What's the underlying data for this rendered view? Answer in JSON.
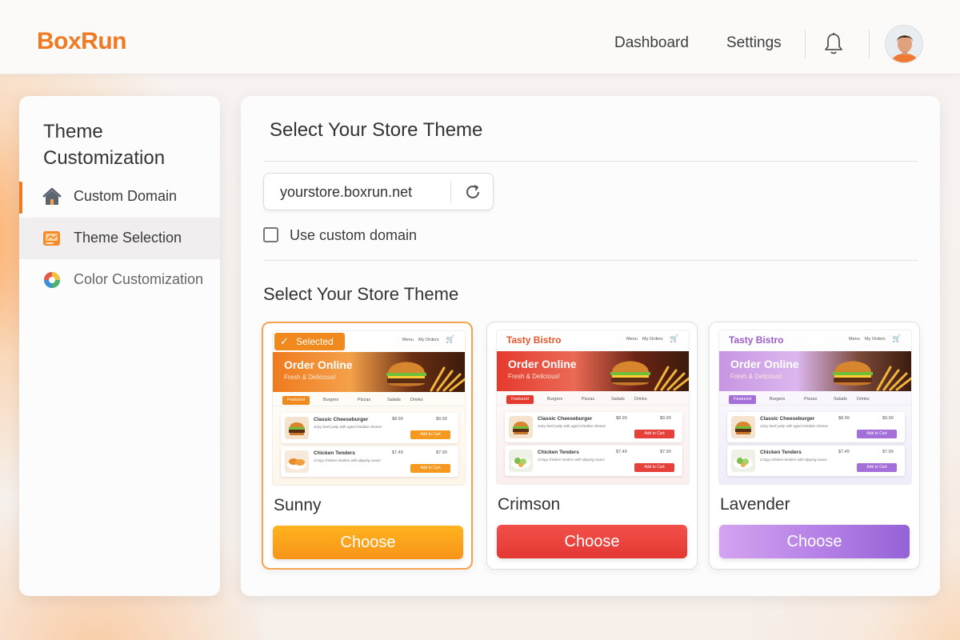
{
  "header": {
    "brand": "BoxRun",
    "nav": [
      "Dashboard",
      "Settings"
    ],
    "icons": [
      "bell-icon",
      "avatar"
    ]
  },
  "sidebar": {
    "title": "Theme Customization",
    "items": [
      {
        "label": "Custom Domain",
        "icon": "home-icon",
        "state": "active-accent"
      },
      {
        "label": "Theme Selection",
        "icon": "palette-card-icon",
        "state": "highlighted"
      },
      {
        "label": "Color Customization",
        "icon": "color-wheel-icon",
        "state": "default"
      }
    ]
  },
  "main": {
    "title": "Select Your Store Theme",
    "domain": {
      "value": "yourstore.boxrun.net",
      "refresh_icon": "refresh-icon"
    },
    "custom_domain_checkbox": {
      "label": "Use custom domain",
      "checked": false
    },
    "section_title": "Select Your Store Theme"
  },
  "preview": {
    "brand": "Tasty Bistro",
    "selected_badge": "Selected",
    "nav_menu": "Menu",
    "nav_orders": "My Orders",
    "hero_title": "Order Online",
    "hero_sub": "Fresh & Delicious!",
    "tabs": [
      "Featured",
      "Burgers",
      "Pizzas",
      "Salads",
      "Drinks"
    ],
    "items": [
      {
        "name": "Classic Cheeseburger",
        "desc": "Juicy beef patty with aged cheddar cheese",
        "price1": "$8.99",
        "price2": "$9.99",
        "button": "Add to Cart"
      },
      {
        "name": "Chicken Tenders",
        "desc": "Crispy chicken tenders with dipping sauce",
        "price1": "$7.49",
        "price2": "$7.99",
        "button": "Add to Cart"
      }
    ]
  },
  "themes": [
    {
      "name": "Sunny",
      "button": "Choose",
      "selected": true,
      "color": "#f7941a"
    },
    {
      "name": "Crimson",
      "button": "Choose",
      "selected": false,
      "color": "#e43834"
    },
    {
      "name": "Lavender",
      "button": "Choose",
      "selected": false,
      "color": "#a874e2"
    }
  ]
}
